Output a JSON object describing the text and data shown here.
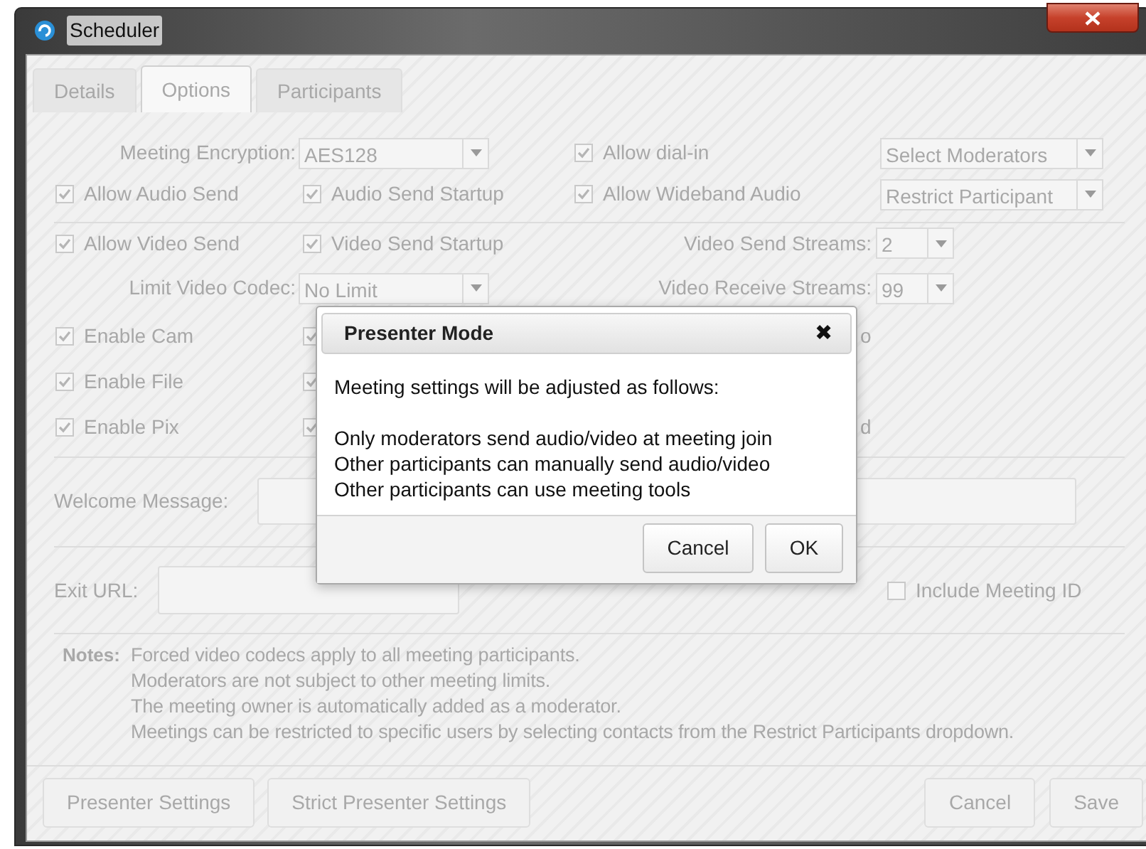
{
  "window": {
    "title": "Scheduler"
  },
  "tabs": [
    {
      "label": "Details",
      "selected": false
    },
    {
      "label": "Options",
      "selected": true
    },
    {
      "label": "Participants",
      "selected": false
    }
  ],
  "options": {
    "disabled": true,
    "encryption": {
      "label": "Meeting Encryption:",
      "value": "AES128"
    },
    "allow_dial_in": {
      "label": "Allow dial-in",
      "checked": true
    },
    "select_moderators": {
      "value": "Select Moderators"
    },
    "audio_row": [
      {
        "label": "Allow Audio Send",
        "checked": true
      },
      {
        "label": "Audio Send Startup",
        "checked": true
      },
      {
        "label": "Allow Wideband Audio",
        "checked": true
      }
    ],
    "restrict_participants": {
      "value": "Restrict Participant"
    },
    "video_row": [
      {
        "label": "Allow Video Send",
        "checked": true
      },
      {
        "label": "Video Send Startup",
        "checked": true
      }
    ],
    "video_send_streams": {
      "label": "Video Send Streams:",
      "value": "2"
    },
    "video_codec": {
      "label": "Limit Video Codec:",
      "value": "No Limit"
    },
    "video_receive_streams": {
      "label": "Video Receive Streams:",
      "value": "99"
    },
    "enable_rows": [
      {
        "checkbox": {
          "label": "Enable Cam",
          "checked": true
        },
        "column_2": {
          "checked": true
        },
        "column_3": {
          "label": "o"
        }
      },
      {
        "checkbox": {
          "label": "Enable File",
          "checked": true
        },
        "column_2": {
          "checked": true
        }
      },
      {
        "checkbox": {
          "label": "Enable Pix",
          "checked": true
        },
        "column_2": {
          "checked": true
        },
        "column_3": {
          "label": "d"
        }
      }
    ],
    "welcome_message": {
      "label": "Welcome Message:"
    },
    "exit_url": {
      "label": "Exit URL:"
    },
    "include_meeting_id": {
      "label": "Include Meeting ID",
      "checked": false
    },
    "notes": {
      "label": "Notes:",
      "lines": [
        "Forced video codecs apply to all meeting participants.",
        "Moderators are not subject to other meeting limits.",
        "The meeting owner is automatically added as a moderator.",
        "Meetings can be restricted to specific users by selecting contacts from the Restrict Participants dropdown."
      ]
    },
    "buttons_left": [
      "Presenter Settings",
      "Strict Presenter Settings"
    ],
    "buttons_right": [
      "Cancel",
      "Save"
    ]
  },
  "dialog": {
    "title": "Presenter Mode",
    "close": "✖",
    "intro": "Meeting settings will be adjusted as follows:",
    "lines": [
      "Only moderators send audio/video at meeting join",
      "Other participants can manually send audio/video",
      "Other participants can use meeting tools"
    ],
    "buttons": [
      "Cancel",
      "OK"
    ]
  }
}
